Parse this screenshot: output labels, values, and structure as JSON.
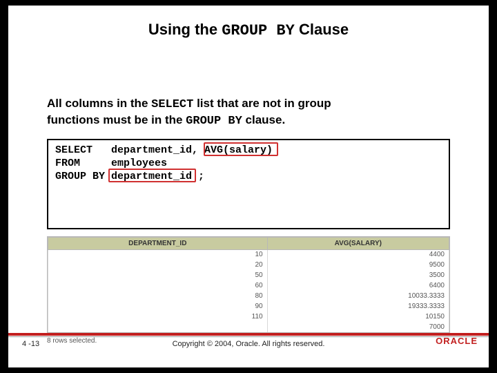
{
  "title": {
    "pre": "Using the ",
    "mono": "GROUP BY",
    "post": " Clause"
  },
  "desc": {
    "l1a": "All columns in the ",
    "l1b": "SELECT",
    "l1c": " list that are not in group",
    "l2a": "functions must be in the ",
    "l2b": "GROUP BY",
    "l2c": " clause."
  },
  "code": {
    "line1": "SELECT   department_id, AVG(salary)",
    "line2": "FROM     employees",
    "line3": "GROUP BY department_id ;"
  },
  "table": {
    "headers": [
      "DEPARTMENT_ID",
      "AVG(SALARY)"
    ],
    "rows": [
      [
        "10",
        "4400"
      ],
      [
        "20",
        "9500"
      ],
      [
        "50",
        "3500"
      ],
      [
        "60",
        "6400"
      ],
      [
        "80",
        "10033.3333"
      ],
      [
        "90",
        "19333.3333"
      ],
      [
        "110",
        "10150"
      ],
      [
        "",
        "7000"
      ]
    ]
  },
  "rows_note": "8 rows selected.",
  "footer": {
    "slide": "4 -13",
    "copyright": "Copyright © 2004, Oracle. All rights reserved.",
    "logo": "ORACLE"
  }
}
